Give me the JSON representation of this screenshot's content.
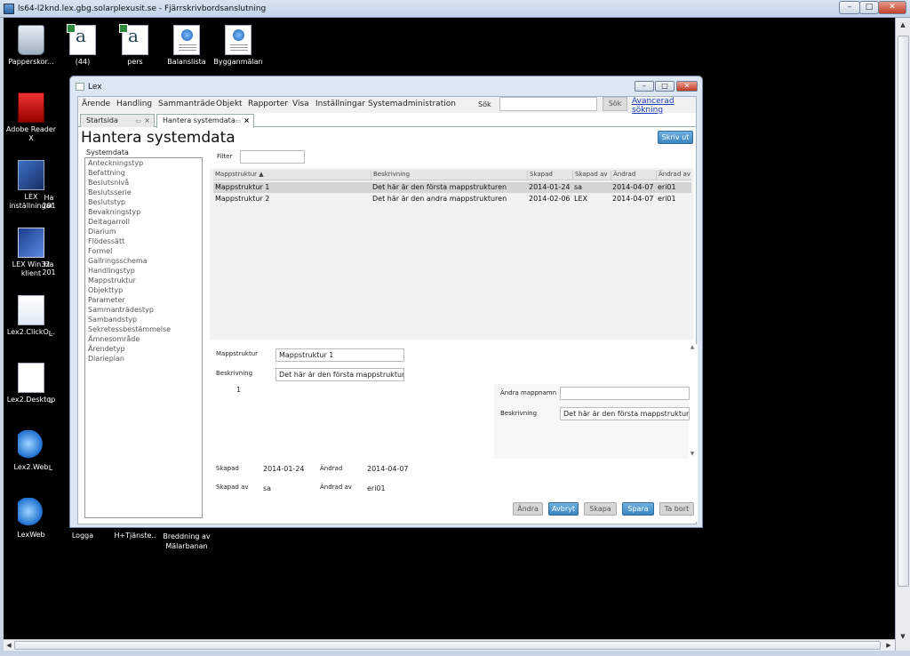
{
  "rdp": {
    "title": "ls64-l2knd.lex.gbg.solarplexusit.se - Fjärrskrivbordsanslutning",
    "minimize": "–",
    "restore": "□",
    "close": "✕"
  },
  "desktop": {
    "icons": [
      {
        "label": "Papperskor...",
        "icon": "recycle-bin"
      },
      {
        "label": "(44)",
        "icon": "excel-doc"
      },
      {
        "label": "pers",
        "icon": "excel-doc"
      },
      {
        "label": "Balanslista",
        "icon": "web-doc"
      },
      {
        "label": "Bygganmälan",
        "icon": "web-doc"
      },
      {
        "label": "Adobe Reader X",
        "icon": "pdf"
      },
      {
        "label": "LEX inställningar",
        "icon": "tools"
      },
      {
        "label": "LEX Win32 klient",
        "icon": "win-app"
      },
      {
        "label": "Lex2.ClickO...",
        "icon": "clickonce"
      },
      {
        "label": "Lex2.Desktop",
        "icon": "document"
      },
      {
        "label": "Lex2.Web",
        "icon": "ie"
      },
      {
        "label": "LexWeb",
        "icon": "ie"
      },
      {
        "label": "Logga",
        "icon": ""
      },
      {
        "label": "H+Tjänste..",
        "icon": ""
      },
      {
        "label": "Breddning av Mälarbanan",
        "icon": ""
      }
    ],
    "partial_labels": {
      "ha1": "Ha",
      "ha1b": "201",
      "ha2": "Ha",
      "ha2b": "201",
      "l1": "L",
      "l2": "L",
      "l3": "L"
    }
  },
  "lex": {
    "title": "Lex",
    "menu": [
      "Ärende",
      "Handling",
      "Sammanträde",
      "Objekt",
      "Rapporter",
      "Visa",
      "Inställningar",
      "Systemadministration"
    ],
    "search_label": "Sök",
    "search_placeholder": "",
    "search_button": "Sök",
    "advanced_search": "Avancerad sökning",
    "tabs": [
      {
        "label": "Startsida"
      },
      {
        "label": "Hantera systemdata"
      }
    ],
    "page_title": "Hantera systemdata",
    "print_button": "Skriv ut",
    "systemdata_label": "Systemdata",
    "systemdata_items": [
      "Anteckningstyp",
      "Befattning",
      "Beslutsnivå",
      "Beslutsserie",
      "Beslutstyp",
      "Bevakningstyp",
      "Deltagarroll",
      "Diarium",
      "Flödessätt",
      "Formel",
      "Gallringsschema",
      "Handlingstyp",
      "Mappstruktur",
      "Objekttyp",
      "Parameter",
      "Sammanträdestyp",
      "Sambandstyp",
      "Sekretessbestämmelse",
      "Ämnesområde",
      "Ärendetyp",
      "Diarieplan"
    ],
    "filter_label": "Filter",
    "filter_value": "",
    "table": {
      "columns": [
        "Mappstruktur ▲",
        "Beskrivning",
        "Skapad",
        "Skapad av",
        "Ändrad",
        "Ändrad av"
      ],
      "rows": [
        [
          "Mappstruktur 1",
          "Det här är den första mappstrukturen",
          "2014-01-24",
          "sa",
          "2014-04-07",
          "eri01"
        ],
        [
          "Mappstruktur 2",
          "Det här är den andra mappstrukturen",
          "2014-02-06",
          "LEX",
          "2014-04-07",
          "eri01"
        ]
      ]
    },
    "detail": {
      "mappstruktur_label": "Mappstruktur",
      "mappstruktur_value": "Mappstruktur 1",
      "beskrivning_label": "Beskrivning",
      "beskrivning_value": "Det här är den första mappstrukturen",
      "line_number": "1",
      "andra_mappnamn_label": "Ändra mappnamn",
      "andra_mappnamn_value": "",
      "right_beskrivning_label": "Beskrivning",
      "right_beskrivning_value": "Det här är den första mappstrukturen",
      "skapad_label": "Skapad",
      "skapad_value": "2014-01-24",
      "andrad_label": "Ändrad",
      "andrad_value": "2014-04-07",
      "skapad_av_label": "Skapad av",
      "skapad_av_value": "sa",
      "andrad_av_label": "Ändrad av",
      "andrad_av_value": "eri01"
    },
    "buttons": {
      "andra": "Ändra",
      "avbryt": "Avbryt",
      "skapa": "Skapa",
      "spara": "Spara",
      "ta_bort": "Ta bort"
    }
  }
}
